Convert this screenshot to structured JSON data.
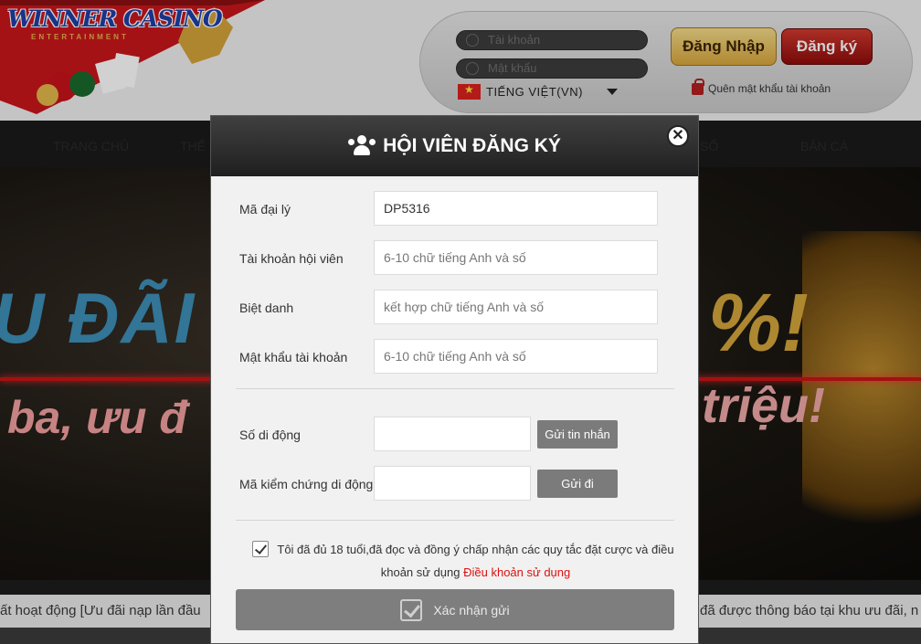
{
  "header": {
    "logo_text": "WINNER CASINO",
    "logo_sub": "ENTERTAINMENT",
    "account_placeholder": "Tài khoản",
    "password_placeholder": "Mật khẩu",
    "language": "TIẾNG VIỆT(VN)",
    "login_label": "Đăng Nhập",
    "register_label": "Đăng ký",
    "forgot_password": "Quên mật khẩu tài khoản"
  },
  "nav": {
    "items": [
      "TRANG CHỦ",
      "THỂ T",
      "SỐ",
      "BẮN CÁ"
    ]
  },
  "banner": {
    "headline_left": "U ĐÃI",
    "headline_right": "%!",
    "subline_left": "ba, ưu đ",
    "subline_right": "triệu!"
  },
  "ticker": {
    "left_text": "ất hoạt động [Ưu đãi nạp lần đầu",
    "right_text": "đã được thông báo tại khu ưu đãi, n"
  },
  "modal": {
    "title": "HỘI VIÊN ĐĂNG KÝ",
    "close_symbol": "✕",
    "agent_code_label": "Mã đại lý",
    "agent_code_value": "DP5316",
    "account_label": "Tài khoản hội viên",
    "account_placeholder": "6-10 chữ tiếng Anh và số",
    "nickname_label": "Biệt danh",
    "nickname_placeholder": "kết hợp chữ tiếng Anh và số",
    "password_label": "Mật khẩu tài khoản",
    "password_placeholder": "6-10 chữ tiếng Anh và số",
    "phone_label": "Số di động",
    "send_sms_label": "Gửi tin nhắn",
    "verify_label": "Mã kiểm chứng di động",
    "send_code_label": "Gửi đi",
    "agree_text": "Tôi đã đủ 18 tuổi,đã đọc và đồng ý chấp nhận các quy tắc đặt cược và điều khoản sử dụng ",
    "terms_link": "Điều khoản sử dụng",
    "submit_label": "Xác nhận gửi"
  },
  "colors": {
    "accent_gold": "#d9a73d",
    "accent_red": "#8e0c0c",
    "modal_header": "#2a2a2a",
    "button_gray": "#7b7b7b",
    "link_red": "#dd1111"
  }
}
